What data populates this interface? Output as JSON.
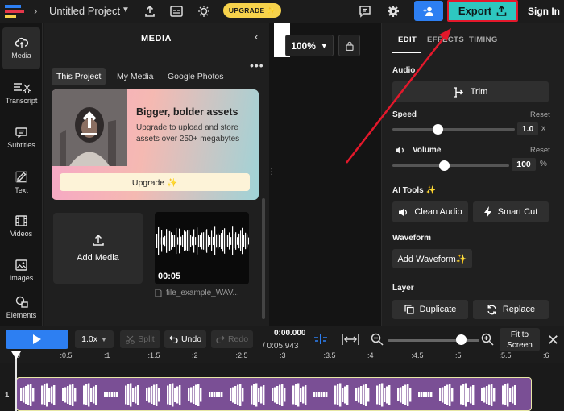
{
  "app": {
    "project_title": "Untitled Project",
    "upgrade_pill": "UPGRADE ✨",
    "export_label": "Export",
    "signin_label": "Sign In"
  },
  "rail": {
    "items": [
      {
        "label": "Media",
        "icon": "upload-cloud-icon"
      },
      {
        "label": "Transcript",
        "icon": "transcript-icon"
      },
      {
        "label": "Subtitles",
        "icon": "subtitles-icon"
      },
      {
        "label": "Text",
        "icon": "text-edit-icon"
      },
      {
        "label": "Videos",
        "icon": "film-icon"
      },
      {
        "label": "Images",
        "icon": "image-icon"
      },
      {
        "label": "Elements",
        "icon": "shapes-icon"
      }
    ]
  },
  "media": {
    "title": "MEDIA",
    "tabs": [
      "This Project",
      "My Media",
      "Google Photos"
    ],
    "promo_heading": "Bigger, bolder assets",
    "promo_text": "Upgrade to upload and store assets over 250+ megabytes",
    "promo_button": "Upgrade ✨",
    "add_media_label": "Add Media",
    "file_duration": "00:05",
    "file_name": "file_example_WAV..."
  },
  "canvas": {
    "zoom": "100%"
  },
  "edit": {
    "tabs": [
      "EDIT",
      "EFFECTS",
      "TIMING"
    ],
    "audio_label": "Audio",
    "trim_label": "Trim",
    "speed_label": "Speed",
    "speed_reset": "Reset",
    "speed_value": "1.0",
    "speed_unit": "x",
    "speed_level": 0.37,
    "volume_label": "Volume",
    "volume_reset": "Reset",
    "volume_value": "100",
    "volume_unit": "%",
    "volume_level": 0.44,
    "ai_tools_label": "AI Tools ✨",
    "clean_audio_label": "Clean Audio",
    "smart_cut_label": "Smart Cut",
    "waveform_label": "Waveform",
    "add_waveform_label": "Add Waveform✨",
    "layer_label": "Layer",
    "duplicate_label": "Duplicate",
    "replace_label": "Replace"
  },
  "timeline": {
    "speed": "1.0x",
    "split_label": "Split",
    "undo_label": "Undo",
    "redo_label": "Redo",
    "current_time": "0:00.000",
    "total_time": "/ 0:05.943",
    "fit_label": "Fit to Screen",
    "zoom_level": 0.8,
    "ruler": [
      "0",
      ":0.5",
      ":1",
      ":1.5",
      ":2",
      ":2.5",
      ":3",
      ":3.5",
      ":4",
      ":4.5",
      ":5",
      ":5.5",
      ":6"
    ],
    "track_number": "1"
  },
  "colors": {
    "accent_blue": "#2d7ff2",
    "export_teal": "#2ec7c0",
    "highlight_red": "#e3182b",
    "upgrade_yellow": "#f6d24b",
    "clip_purple": "#7a4f95"
  }
}
